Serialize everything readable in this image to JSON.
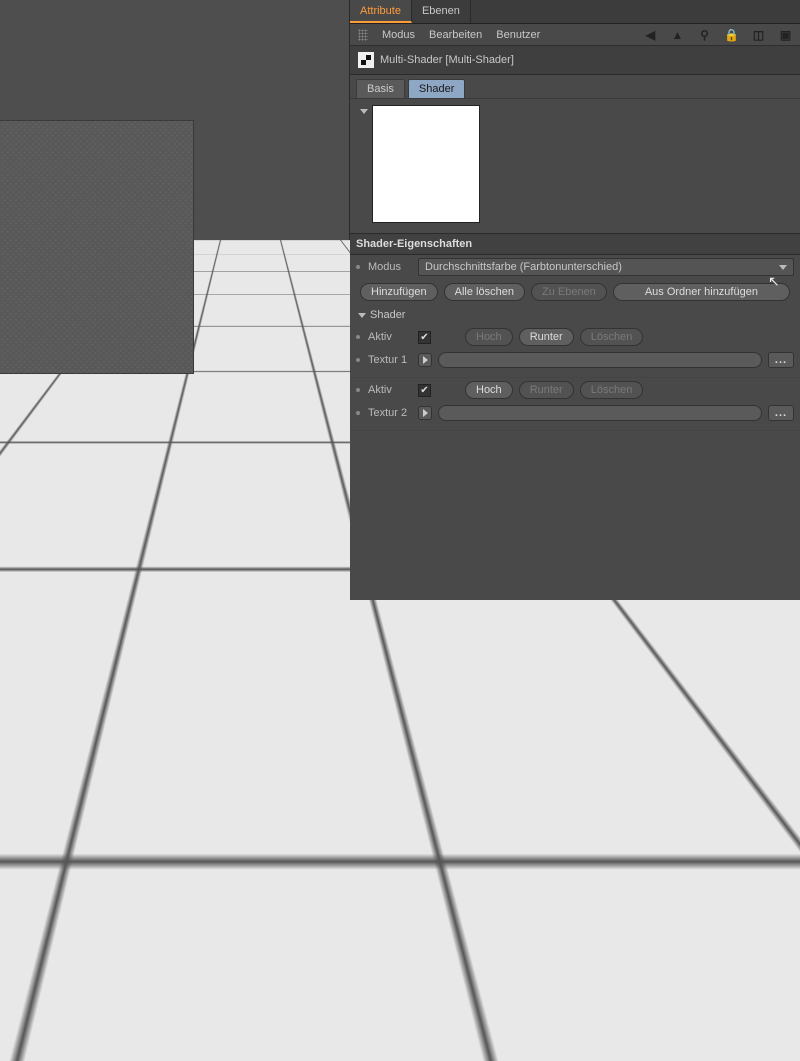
{
  "tabs": {
    "attribute": "Attribute",
    "ebenen": "Ebenen"
  },
  "menu": {
    "modus": "Modus",
    "bearbeiten": "Bearbeiten",
    "benutzer": "Benutzer"
  },
  "title": "Multi-Shader [Multi-Shader]",
  "inner_tabs": {
    "basis": "Basis",
    "shader": "Shader"
  },
  "section": "Shader-Eigenschaften",
  "modus_label": "Modus",
  "modus_value": "Durchschnittsfarbe (Farbtonunterschied)",
  "buttons": {
    "add": "Hinzufügen",
    "delete_all": "Alle löschen",
    "to_layers": "Zu Ebenen",
    "from_folder": "Aus Ordner hinzufügen"
  },
  "shader_sub": "Shader",
  "labels": {
    "aktiv": "Aktiv",
    "hoch": "Hoch",
    "runter": "Runter",
    "loeschen": "Löschen"
  },
  "shaders": [
    {
      "textur_label": "Textur 1",
      "aktiv": true,
      "hoch_enabled": false,
      "runter_enabled": true,
      "loeschen_enabled": false
    },
    {
      "textur_label": "Textur 2",
      "aktiv": true,
      "hoch_enabled": true,
      "runter_enabled": false,
      "loeschen_enabled": false
    }
  ],
  "icons": {
    "nav_back": "◀",
    "nav_up": "▲",
    "search": "⚲",
    "lock": "🔒",
    "new": "◫",
    "maximize": "▣"
  }
}
